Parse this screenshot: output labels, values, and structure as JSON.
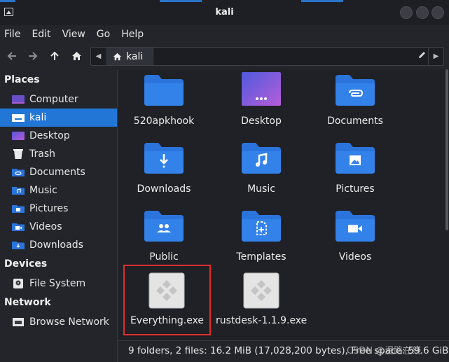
{
  "window": {
    "title": "kali"
  },
  "menu": [
    "File",
    "Edit",
    "View",
    "Go",
    "Help"
  ],
  "toolbar": {
    "breadcrumb": "kali"
  },
  "sidebar": {
    "places_heading": "Places",
    "places": [
      {
        "label": "Computer",
        "icon": "computer-icon"
      },
      {
        "label": "kali",
        "icon": "home-folder-icon",
        "selected": true
      },
      {
        "label": "Desktop",
        "icon": "desktop-icon"
      },
      {
        "label": "Trash",
        "icon": "trash-icon"
      },
      {
        "label": "Documents",
        "icon": "documents-icon"
      },
      {
        "label": "Music",
        "icon": "music-icon"
      },
      {
        "label": "Pictures",
        "icon": "pictures-icon"
      },
      {
        "label": "Videos",
        "icon": "videos-icon"
      },
      {
        "label": "Downloads",
        "icon": "downloads-icon"
      }
    ],
    "devices_heading": "Devices",
    "devices": [
      {
        "label": "File System",
        "icon": "drive-icon"
      }
    ],
    "network_heading": "Network",
    "network": [
      {
        "label": "Browse Network",
        "icon": "network-icon"
      }
    ]
  },
  "files": [
    {
      "label": "520apkhook",
      "type": "folder",
      "emblem": "none"
    },
    {
      "label": "Desktop",
      "type": "desktop",
      "emblem": "dots"
    },
    {
      "label": "Documents",
      "type": "folder",
      "emblem": "clip"
    },
    {
      "label": "Downloads",
      "type": "folder",
      "emblem": "download"
    },
    {
      "label": "Music",
      "type": "folder",
      "emblem": "music"
    },
    {
      "label": "Pictures",
      "type": "folder",
      "emblem": "picture"
    },
    {
      "label": "Public",
      "type": "folder",
      "emblem": "people"
    },
    {
      "label": "Templates",
      "type": "folder",
      "emblem": "template"
    },
    {
      "label": "Videos",
      "type": "folder",
      "emblem": "video"
    },
    {
      "label": "Everything.exe",
      "type": "exe",
      "highlighted": true
    },
    {
      "label": "rustdesk-1.1.9.exe",
      "type": "exe"
    }
  ],
  "status": {
    "text": "9 folders, 2 files: 16.2 MiB (17,028,200 bytes), Free space: 59.6 GiB",
    "watermark": "CSDN @漫路在线"
  },
  "colors": {
    "accent": "#2277d6",
    "folder": "#2a74dc",
    "highlight": "#e02e2e"
  }
}
